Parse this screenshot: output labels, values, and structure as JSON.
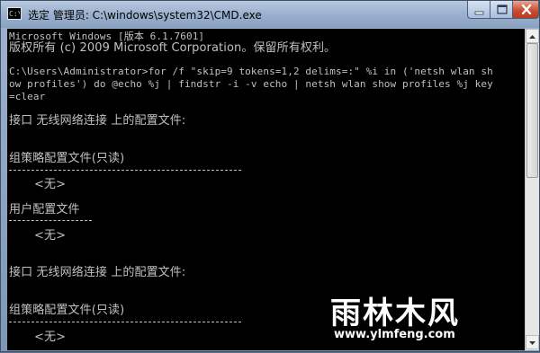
{
  "window": {
    "title": "选定 管理员: C:\\windows\\system32\\CMD.exe",
    "controls": {
      "minimize": "minimize-icon",
      "maximize": "maximize-icon",
      "close": "close-icon"
    }
  },
  "console": {
    "line_version": "Microsoft Windows [版本 6.1.7601]",
    "line_copyright": "版权所有 (c) 2009 Microsoft Corporation。保留所有权利。",
    "command_1": "C:\\Users\\Administrator>for /f \"skip=9 tokens=1,2 delims=:\" %i in ('netsh wlan sh",
    "command_2": "ow profiles') do @echo %j | findstr -i -v echo | netsh wlan show profiles %j key",
    "command_3": "=clear",
    "section_a_header": "接口 无线网络连接 上的配置文件:",
    "section_a_group_title": "组策略配置文件(只读)",
    "section_a_group_none": "<无>",
    "section_a_user_title": "用户配置文件",
    "section_a_user_none": "<无>",
    "section_b_header": "接口 无线网络连接 上的配置文件:",
    "section_b_group_title": "组策略配置文件(只读)",
    "section_b_group_none": "<无>"
  },
  "watermark": {
    "title": "雨林木风",
    "url": "www.ylmfeng.com"
  },
  "colors": {
    "console_bg": "#000000",
    "console_text": "#c0c0c0",
    "close_button": "#c8492d"
  }
}
